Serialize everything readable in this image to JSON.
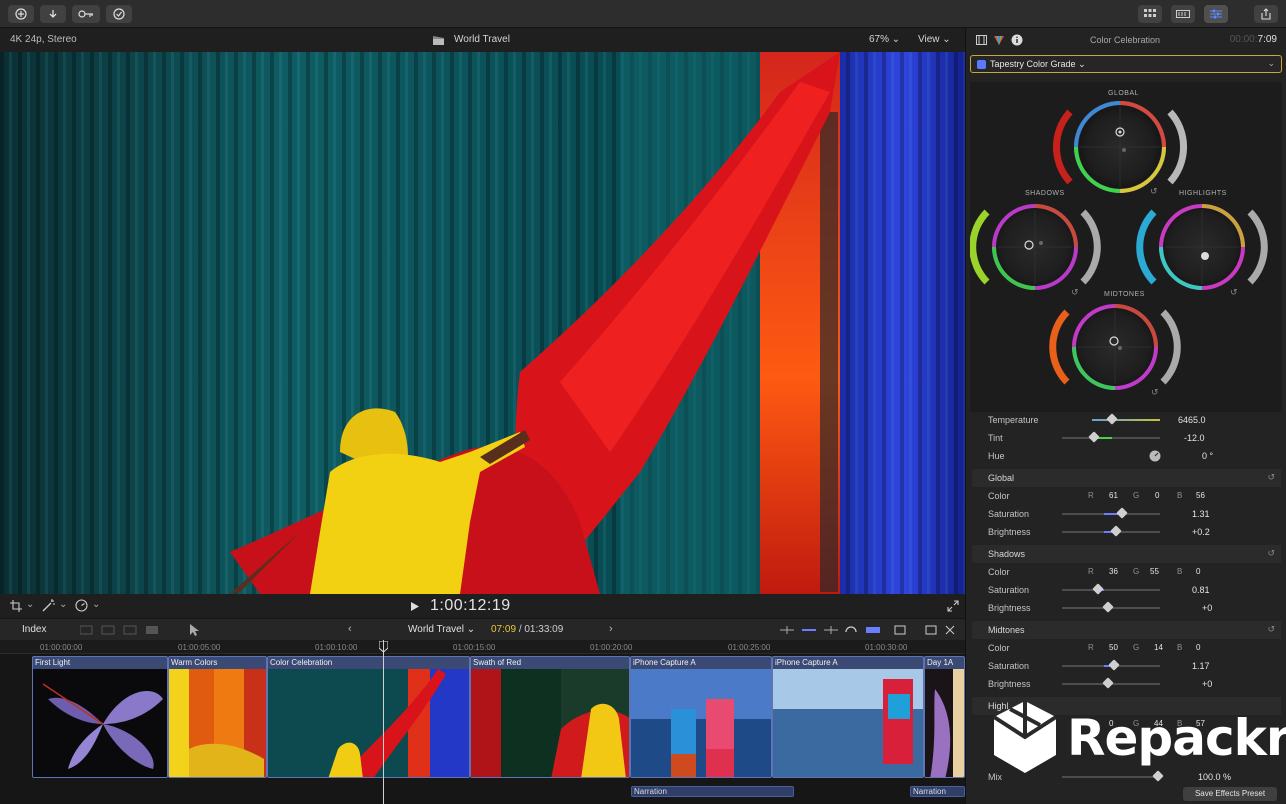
{
  "toolbar": {
    "icons": [
      "import-icon",
      "download-icon",
      "key-icon",
      "check-icon",
      "grid-icon",
      "filmstrip-icon",
      "sliders-icon",
      "share-icon"
    ]
  },
  "viewer": {
    "format": "4K 24p, Stereo",
    "project": "World Travel",
    "zoom": "67%",
    "view": "View",
    "timecode": "1:00:12:19"
  },
  "timeline": {
    "index": "Index",
    "project": "World Travel",
    "current": "07:09",
    "total": "/ 01:33:09",
    "ruler": [
      "01:00:00:00",
      "01:00:05:00",
      "01:00:10:00",
      "01:00:15:00",
      "01:00:20:00",
      "01:00:25:00",
      "01:00:30:00"
    ],
    "clips": [
      {
        "label": "First Light"
      },
      {
        "label": "Warm Colors"
      },
      {
        "label": "Color Celebration"
      },
      {
        "label": "Swath of Red"
      },
      {
        "label": "iPhone Capture A"
      },
      {
        "label": "iPhone Capture A"
      },
      {
        "label": "Day 1A"
      }
    ],
    "narration": [
      "Narration",
      "Narration"
    ]
  },
  "inspector": {
    "title": "Color Celebration",
    "duration_prefix": "00:00:",
    "duration": "7:09",
    "effect": "Tapestry Color Grade",
    "wheels": {
      "global": "GLOBAL",
      "shadows": "SHADOWS",
      "highlights": "HIGHLIGHTS",
      "midtones": "MIDTONES"
    },
    "temperature": {
      "label": "Temperature",
      "value": "6465.0"
    },
    "tint": {
      "label": "Tint",
      "value": "-12.0"
    },
    "hue": {
      "label": "Hue",
      "value": "0 °"
    },
    "global": {
      "title": "Global",
      "color": "Color",
      "r": "61",
      "g": "0",
      "b": "56",
      "saturation": "Saturation",
      "sat_value": "1.31",
      "brightness": "Brightness",
      "bri_value": "+0.2"
    },
    "shadows": {
      "title": "Shadows",
      "color": "Color",
      "r": "36",
      "g": "55",
      "b": "0",
      "saturation": "Saturation",
      "sat_value": "0.81",
      "brightness": "Brightness",
      "bri_value": "+0"
    },
    "midtones": {
      "title": "Midtones",
      "color": "Color",
      "r": "50",
      "g": "14",
      "b": "0",
      "saturation": "Saturation",
      "sat_value": "1.17",
      "brightness": "Brightness",
      "bri_value": "+0"
    },
    "highlights": {
      "title": "Highl",
      "r": "0",
      "g": "44",
      "b": "57"
    },
    "mix": {
      "label": "Mix",
      "value": "100.0 %"
    },
    "save": "Save Effects Preset",
    "rgb": {
      "r": "R",
      "g": "G",
      "b": "B"
    }
  },
  "watermark": {
    "text": "Repackra"
  },
  "colors": {
    "accent": "#5b7bff",
    "timecode": "#e9c73a",
    "clip": "#3a4a75"
  }
}
